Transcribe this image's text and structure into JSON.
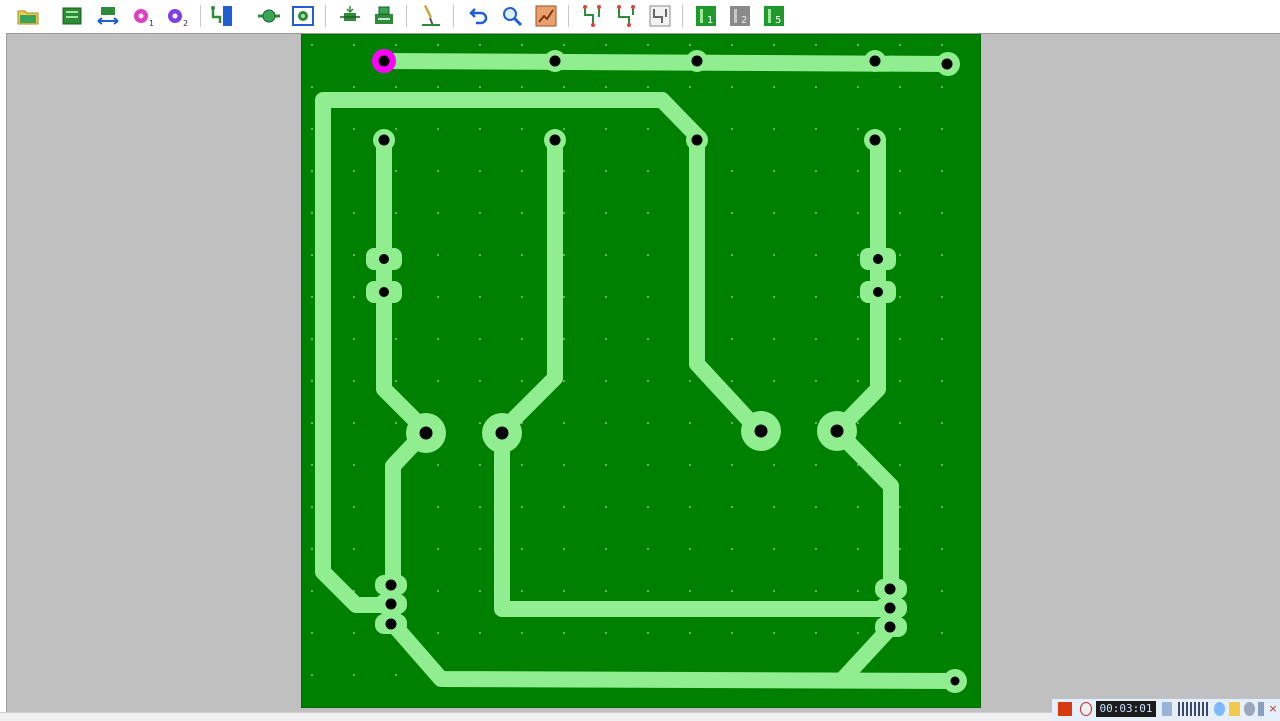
{
  "toolbar": {
    "buttons": [
      {
        "name": "open-file-button",
        "icon": "folder-icon"
      },
      {
        "name": "board-outline-button",
        "icon": "board-icon"
      },
      {
        "name": "flip-board-button",
        "icon": "horizontal-arrows-icon"
      },
      {
        "name": "pad-layer-1-button",
        "icon": "pad-1-icon",
        "badge": "1"
      },
      {
        "name": "pad-layer-2-button",
        "icon": "pad-2-icon",
        "badge": "2"
      },
      {
        "name": "route-button",
        "icon": "route-icon"
      },
      {
        "name": "place-pad-button",
        "icon": "pad-icon"
      },
      {
        "name": "via-button",
        "icon": "via-icon"
      },
      {
        "name": "add-component-button",
        "icon": "component-icon"
      },
      {
        "name": "export-button",
        "icon": "export-icon"
      },
      {
        "name": "drill-button",
        "icon": "drill-icon"
      },
      {
        "name": "undo-button",
        "icon": "undo-icon"
      },
      {
        "name": "zoom-button",
        "icon": "magnifier-icon"
      },
      {
        "name": "autoroute-button",
        "icon": "autoroute-icon"
      },
      {
        "name": "netlist-1-button",
        "icon": "netlist-icon"
      },
      {
        "name": "netlist-2-button",
        "icon": "netlist-icon"
      },
      {
        "name": "netlist-3-button",
        "icon": "netlist-icon"
      },
      {
        "name": "layer-1-button",
        "icon": "layer-icon",
        "badge": "1"
      },
      {
        "name": "layer-2-button",
        "icon": "layer-icon",
        "badge": "2"
      },
      {
        "name": "layer-5-button",
        "icon": "layer-icon",
        "badge": "5"
      }
    ]
  },
  "board": {
    "colors": {
      "substrate": "#008000",
      "copper": "#90ee90",
      "hole": "#000000",
      "selected_pad": "#ff00ff",
      "grid_dot": "#7fc57f"
    }
  },
  "taskbar": {
    "clock": "00:03:01"
  }
}
